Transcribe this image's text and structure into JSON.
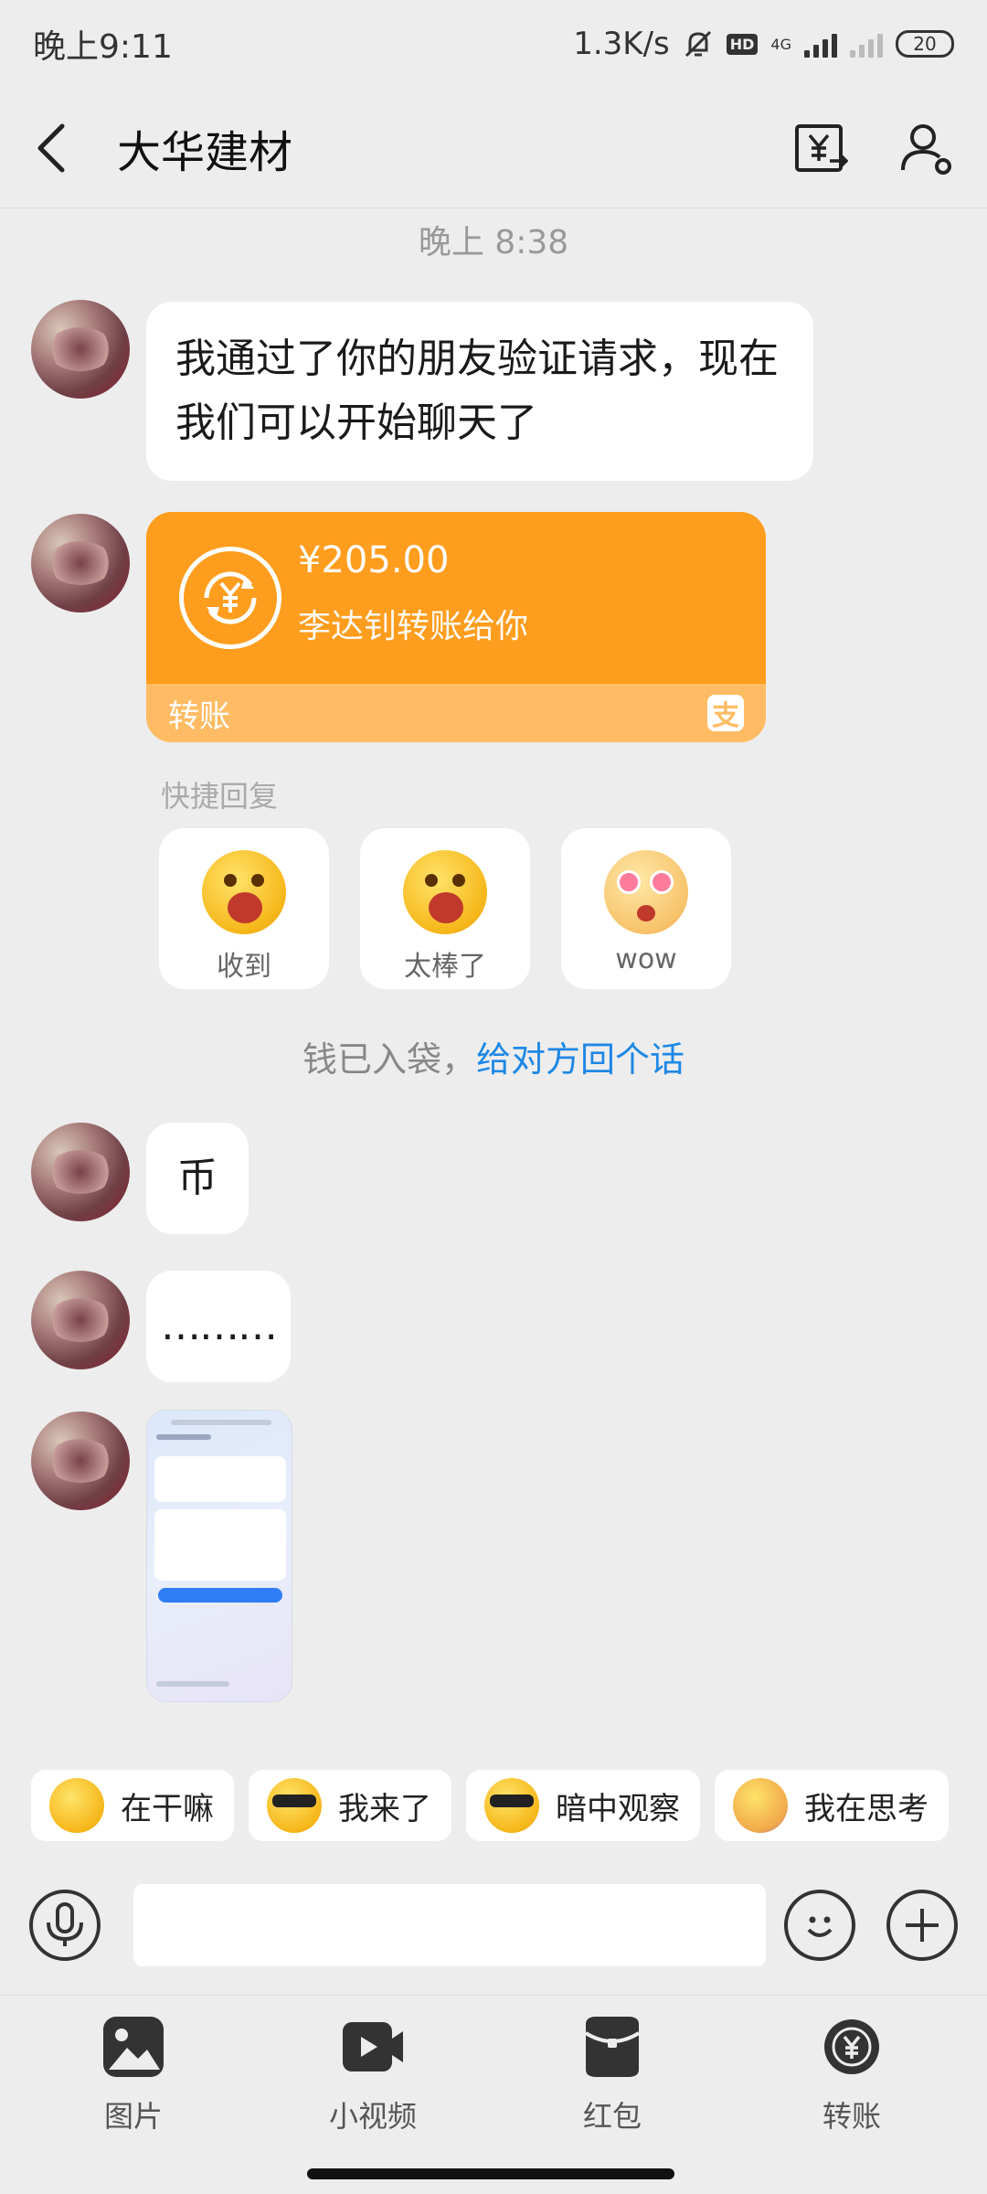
{
  "status_bar": {
    "time": "晚上9:11",
    "net_speed": "1.3K/s",
    "hd": "HD",
    "network": "4G",
    "battery": "20"
  },
  "nav": {
    "title": "大华建材"
  },
  "chat": {
    "time_label": "晚上 8:38",
    "msg_friend": "我通过了你的朋友验证请求，现在我们可以开始聊天了",
    "transfer": {
      "amount": "¥205.00",
      "desc": "李达钊转账给你",
      "type": "转账",
      "logo": "支"
    },
    "quick_reply": {
      "title": "快捷回复",
      "items": [
        {
          "label": "收到"
        },
        {
          "label": "太棒了"
        },
        {
          "label": "wow"
        }
      ]
    },
    "notice": {
      "text": "钱已入袋，",
      "link": "给对方回个话"
    },
    "msg_coin": "币",
    "msg_dots": "………"
  },
  "stickers": [
    {
      "label": "在干嘛"
    },
    {
      "label": "我来了"
    },
    {
      "label": "暗中观察"
    },
    {
      "label": "我在思考"
    }
  ],
  "input": {
    "value": ""
  },
  "tools": [
    {
      "label": "图片",
      "icon": "image-icon"
    },
    {
      "label": "小视频",
      "icon": "video-icon"
    },
    {
      "label": "红包",
      "icon": "red-packet-icon"
    },
    {
      "label": "转账",
      "icon": "transfer-icon"
    }
  ],
  "colors": {
    "transfer_orange": "#FF9D1E",
    "transfer_light": "#FFBC64",
    "link_blue": "#1E88E5",
    "background": "#EDEDED"
  }
}
